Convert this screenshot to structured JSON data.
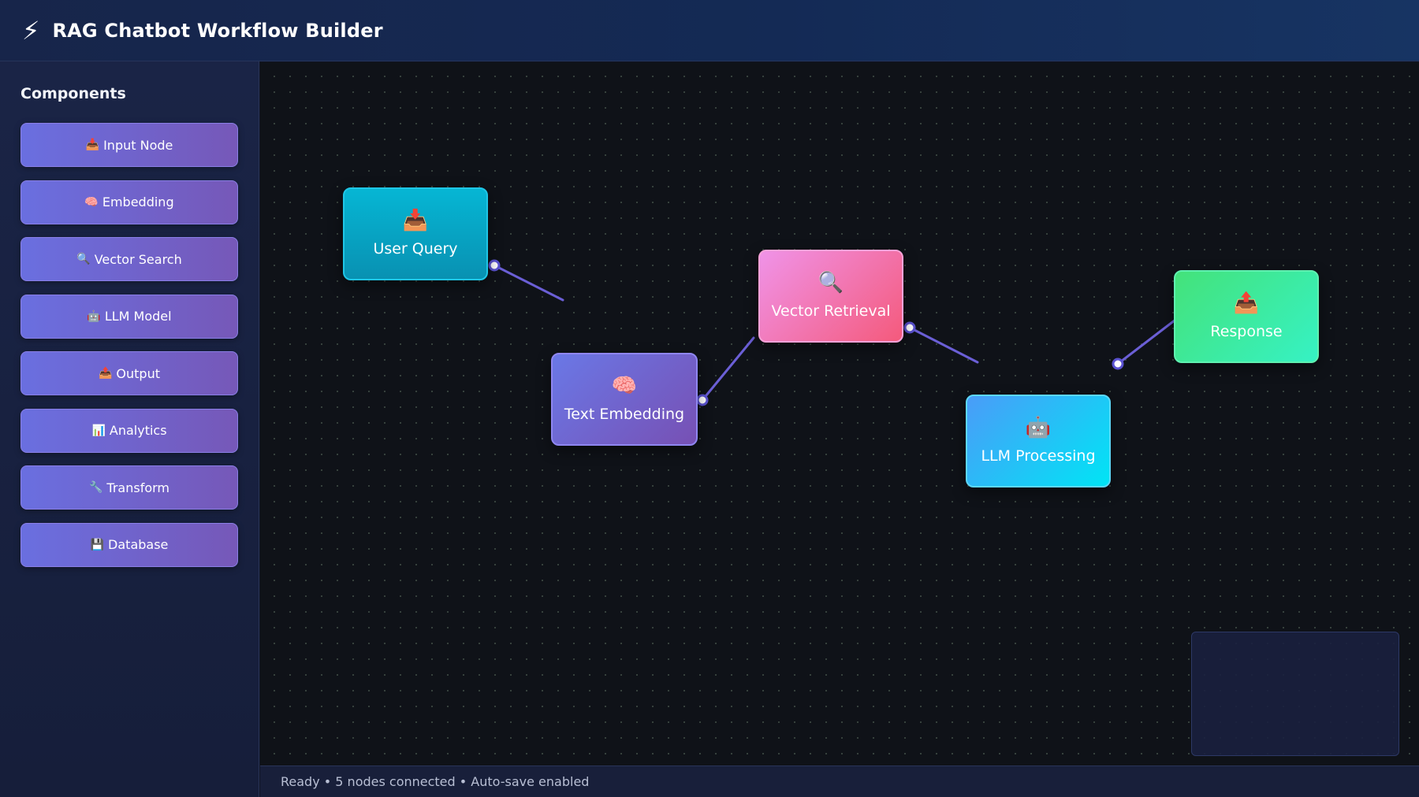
{
  "header": {
    "icon": "⚡",
    "title": "RAG Chatbot Workflow Builder"
  },
  "sidebar": {
    "heading": "Components",
    "items": [
      {
        "icon": "📥",
        "label": "Input Node"
      },
      {
        "icon": "🧠",
        "label": "Embedding"
      },
      {
        "icon": "🔍",
        "label": "Vector Search"
      },
      {
        "icon": "🤖",
        "label": "LLM Model"
      },
      {
        "icon": "📤",
        "label": "Output"
      },
      {
        "icon": "📊",
        "label": "Analytics"
      },
      {
        "icon": "🔧",
        "label": "Transform"
      },
      {
        "icon": "💾",
        "label": "Database"
      }
    ]
  },
  "canvas": {
    "nodes": [
      {
        "icon": "📥",
        "label": "User Query",
        "color": "#06b6d4"
      },
      {
        "icon": "🧠",
        "label": "Text Embedding",
        "color": "#6a78e6"
      },
      {
        "icon": "🔍",
        "label": "Vector Retrieval",
        "color": "#f45a7c"
      },
      {
        "icon": "🤖",
        "label": "LLM Processing",
        "color": "#00e5f5"
      },
      {
        "icon": "📤",
        "label": "Response",
        "color": "#36f2c4"
      }
    ],
    "connection_color": "#6b5fd6"
  },
  "status": {
    "text": "Ready • 5 nodes connected • Auto-save enabled"
  }
}
